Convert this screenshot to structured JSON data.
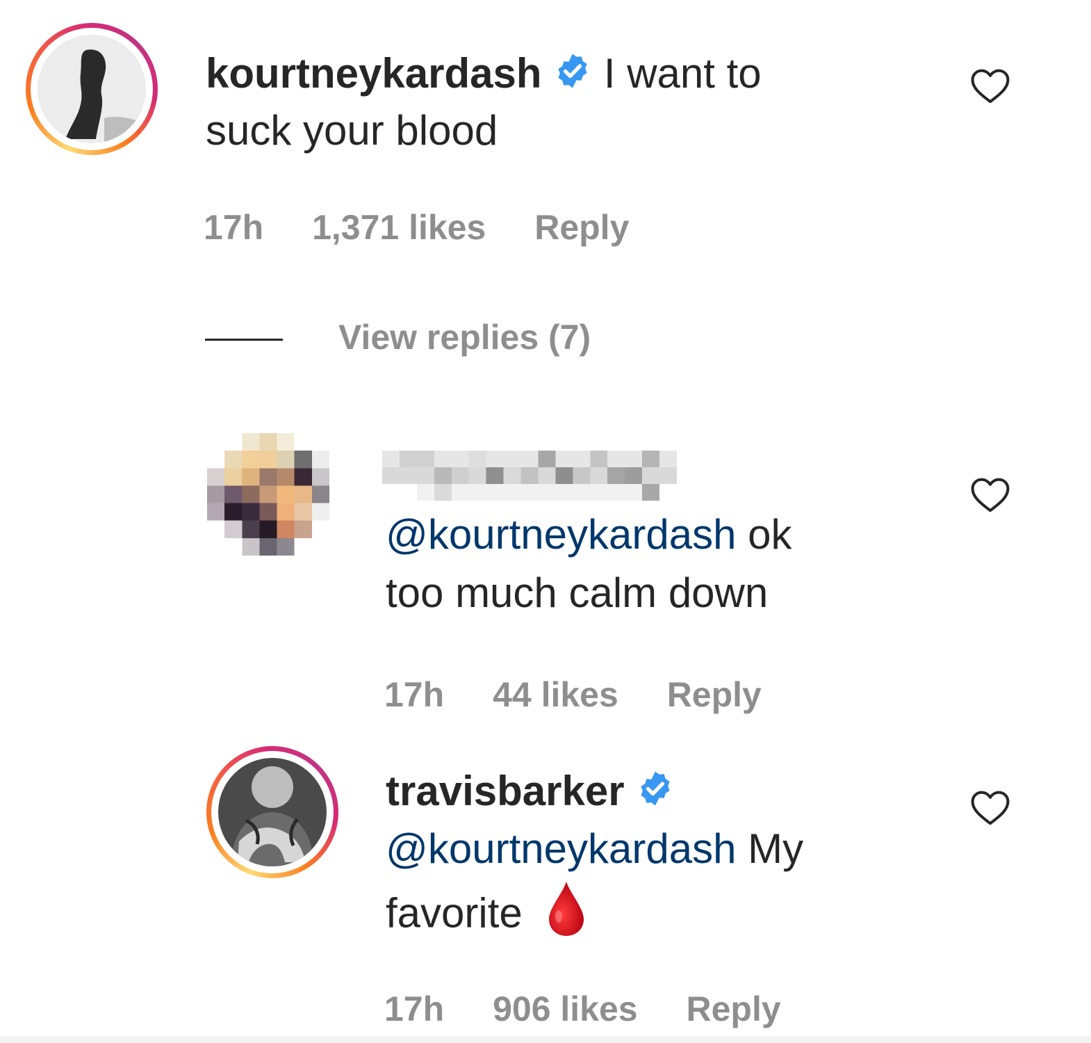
{
  "comments": [
    {
      "username": "kourtneykardash",
      "verified": true,
      "text_line1": "I want to",
      "text_line2": "suck your blood",
      "time": "17h",
      "likes": "1,371 likes",
      "reply_label": "Reply",
      "view_replies": "View replies (7)",
      "like_icon": "heart-outline-icon"
    },
    {
      "username": "",
      "username_redacted": true,
      "mention": "@kourtneykardash",
      "text_line1_rest": " ok",
      "text_line2": "too much calm down",
      "time": "17h",
      "likes": "44 likes",
      "reply_label": "Reply",
      "like_icon": "heart-outline-icon"
    },
    {
      "username": "travisbarker",
      "verified": true,
      "mention": "@kourtneykardash",
      "text_line1_rest": " My",
      "text_line2": "favorite",
      "emoji": "drop-of-blood-icon",
      "time": "17h",
      "likes": "906 likes",
      "reply_label": "Reply",
      "like_icon": "heart-outline-icon"
    }
  ],
  "colors": {
    "verified_blue": "#3897f0",
    "mention_blue": "#00376b",
    "meta_gray": "#8e8e8e",
    "blood_red": "#d0021b"
  }
}
